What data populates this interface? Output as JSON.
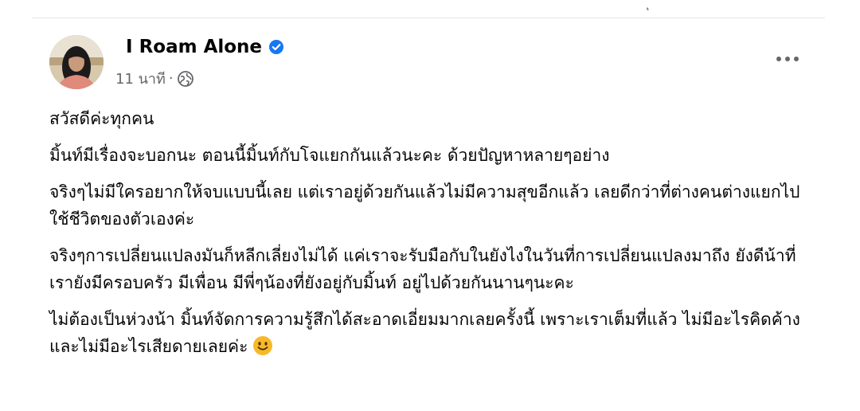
{
  "post": {
    "author": "I Roam Alone",
    "timestamp": "11 นาที",
    "separator": "·",
    "paragraphs": [
      "สวัสดีค่ะทุกคน",
      "มิ้นท์มีเรื่องจะบอกนะ ตอนนี้มิ้นท์กับโจแยกกันแล้วนะคะ ด้วยปัญหาหลายๆอย่าง",
      "จริงๆไม่มีใครอยากให้จบแบบนี้เลย แต่เราอยู่ด้วยกันแล้วไม่มีความสุขอีกแล้ว เลยดีกว่าที่ต่างคนต่างแยกไปใช้ชีวิตของตัวเองค่ะ",
      "จริงๆการเปลี่ยนแปลงมันก็หลีกเลี่ยงไม่ได้ แค่เราจะรับมือกับในยังไงในวันที่การเปลี่ยนแปลงมาถึง ยังดีน้าที่เรายังมีครอบครัว มีเพื่อน มีพี่ๆน้องที่ยังอยู่กับมิ้นท์ อยู่ไปด้วยกันนานๆนะคะ",
      "ไม่ต้องเป็นห่วงน้า มิ้นท์จัดการความรู้สึกได้สะอาดเอี่ยมมากเลยครั้งนี้ เพราะเราเต็มที่แล้ว ไม่มีอะไรคิดค้าง และไม่มีอะไรเสียดายเลยค่ะ"
    ],
    "icons": {
      "verified": "verified-badge-icon",
      "audience": "globe-icon",
      "menu": "more-options-icon",
      "emoji": "smile-emoji-icon"
    },
    "colors": {
      "verified": "#1877f2",
      "meta_text": "#65676b",
      "body_text": "#050505",
      "emoji": "#f7b928"
    }
  }
}
